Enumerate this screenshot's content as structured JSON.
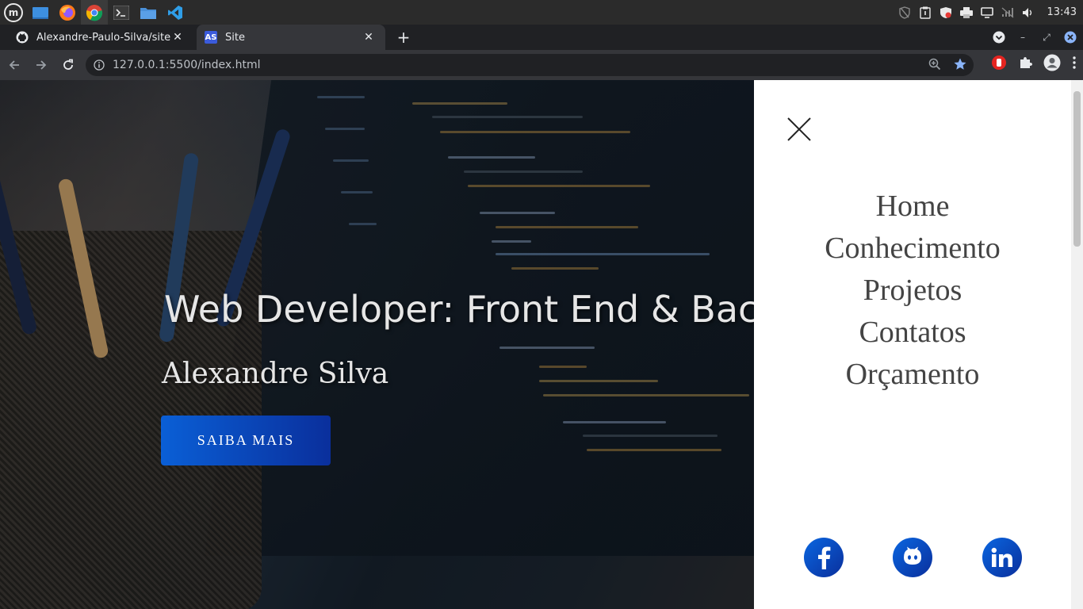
{
  "taskbar": {
    "apps": [
      {
        "name": "mint-menu",
        "icon": "linux-mint-icon"
      },
      {
        "name": "show-desktop",
        "icon": "desktop-icon"
      },
      {
        "name": "firefox",
        "icon": "firefox-icon"
      },
      {
        "name": "chrome",
        "icon": "chrome-icon"
      },
      {
        "name": "terminal",
        "icon": "terminal-icon"
      },
      {
        "name": "files",
        "icon": "folder-icon"
      },
      {
        "name": "vscode",
        "icon": "vscode-icon"
      }
    ],
    "tray_icons": [
      "shield-icon",
      "clipboard-icon",
      "security-icon",
      "printer-icon",
      "display-icon",
      "network-off-icon",
      "volume-icon"
    ],
    "clock": "13:43"
  },
  "browser": {
    "tabs": [
      {
        "title": "Alexandre-Paulo-Silva/site",
        "favicon": "github-icon",
        "active": false
      },
      {
        "title": "Site",
        "favicon_text": "AS",
        "active": true
      }
    ],
    "url": "127.0.0.1:5500/index.html",
    "accent": "#8ab4f8"
  },
  "hero": {
    "title": "Web Developer: Front End & Back End",
    "subtitle": "Alexandre Silva",
    "cta_label": "SAIBA MAIS",
    "cta_colors": [
      "#0a5fd6",
      "#0a2f9c"
    ]
  },
  "side_menu": {
    "links": [
      "Home",
      "Conhecimento",
      "Projetos",
      "Contatos",
      "Orçamento"
    ],
    "socials": [
      "facebook-icon",
      "github-icon",
      "linkedin-icon"
    ]
  }
}
